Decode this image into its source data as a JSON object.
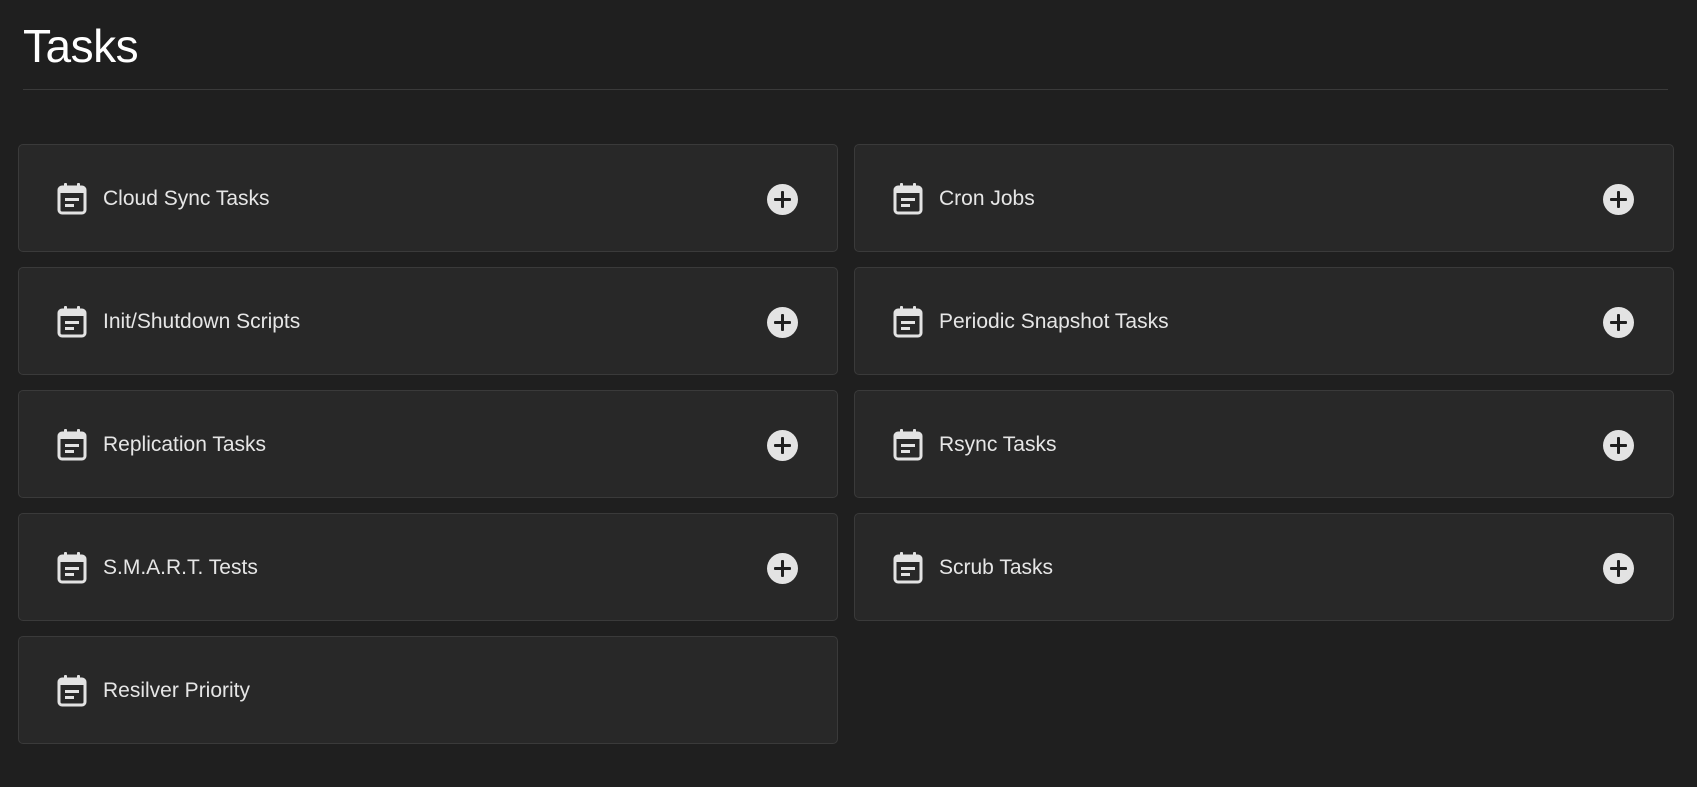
{
  "page": {
    "title": "Tasks"
  },
  "theme": {
    "background": "#1f1f1f",
    "card_background": "#282828",
    "card_border": "#3a3a3a",
    "text": "#e6e6e6",
    "icon": "#e3e3e3"
  },
  "cards": [
    {
      "label": "Cloud Sync Tasks",
      "icon": "calendar-note-icon",
      "has_add": true
    },
    {
      "label": "Cron Jobs",
      "icon": "calendar-note-icon",
      "has_add": true
    },
    {
      "label": "Init/Shutdown Scripts",
      "icon": "calendar-note-icon",
      "has_add": true
    },
    {
      "label": "Periodic Snapshot Tasks",
      "icon": "calendar-note-icon",
      "has_add": true
    },
    {
      "label": "Replication Tasks",
      "icon": "calendar-note-icon",
      "has_add": true
    },
    {
      "label": "Rsync Tasks",
      "icon": "calendar-note-icon",
      "has_add": true
    },
    {
      "label": "S.M.A.R.T. Tests",
      "icon": "calendar-note-icon",
      "has_add": true
    },
    {
      "label": "Scrub Tasks",
      "icon": "calendar-note-icon",
      "has_add": true
    },
    {
      "label": "Resilver Priority",
      "icon": "calendar-note-icon",
      "has_add": false
    }
  ]
}
